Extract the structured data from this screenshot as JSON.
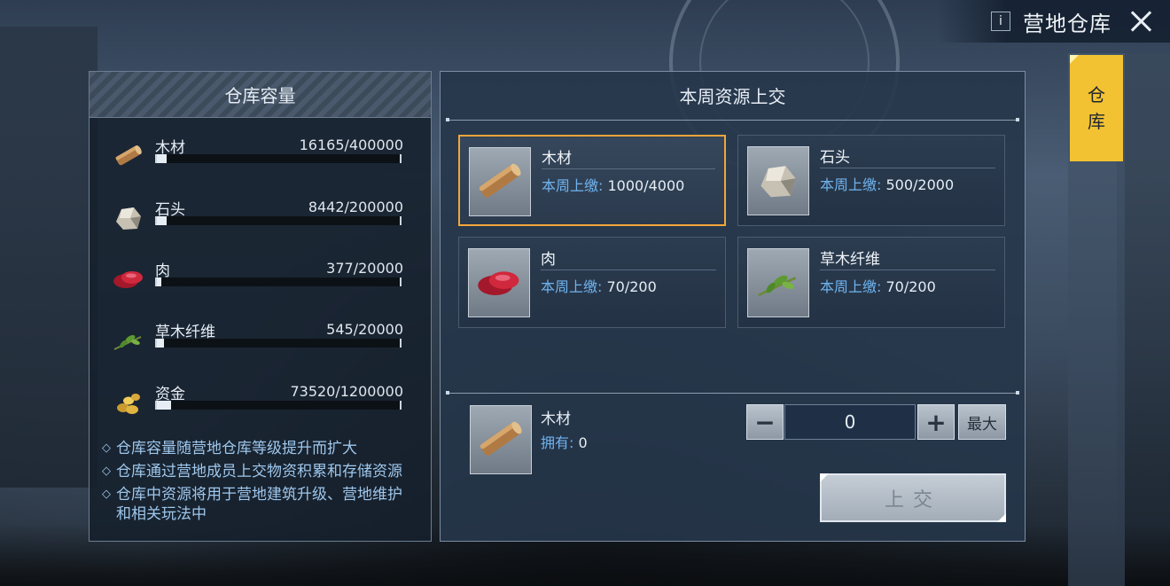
{
  "header": {
    "info_label": "i",
    "title": "营地仓库"
  },
  "side_tab": {
    "line1": "仓",
    "line2": "库"
  },
  "capacity": {
    "title": "仓库容量",
    "items": [
      {
        "name": "木材",
        "value": "16165/400000",
        "fill": 0.04,
        "icon": "wood-icon"
      },
      {
        "name": "石头",
        "value": "8442/200000",
        "fill": 0.04,
        "icon": "stone-icon"
      },
      {
        "name": "肉",
        "value": "377/20000",
        "fill": 0.02,
        "icon": "meat-icon"
      },
      {
        "name": "草木纤维",
        "value": "545/20000",
        "fill": 0.03,
        "icon": "plant-fiber-icon"
      },
      {
        "name": "资金",
        "value": "73520/1200000",
        "fill": 0.06,
        "icon": "gold-icon"
      }
    ],
    "notes": [
      "仓库容量随营地仓库等级提升而扩大",
      "仓库通过营地成员上交物资积累和存储资源",
      "仓库中资源将用于营地建筑升级、营地维护和相关玩法中"
    ]
  },
  "weekly": {
    "title": "本周资源上交",
    "quota_label": "本周上缴:",
    "cards": [
      {
        "name": "木材",
        "quota": "1000/4000",
        "icon": "wood-icon",
        "selected": true
      },
      {
        "name": "石头",
        "quota": "500/2000",
        "icon": "stone-icon",
        "selected": false
      },
      {
        "name": "肉",
        "quota": "70/200",
        "icon": "meat-icon",
        "selected": false
      },
      {
        "name": "草木纤维",
        "quota": "70/200",
        "icon": "plant-fiber-icon",
        "selected": false
      }
    ]
  },
  "submit_area": {
    "selected_name": "木材",
    "own_label": "拥有:",
    "own_value": "0",
    "minus_label": "−",
    "plus_label": "+",
    "quantity": "0",
    "max_label": "最大",
    "submit_label": "上交"
  },
  "colors": {
    "accent": "#f2c232",
    "selected_border": "#f1a63a",
    "label_blue": "#6fb3ee"
  }
}
